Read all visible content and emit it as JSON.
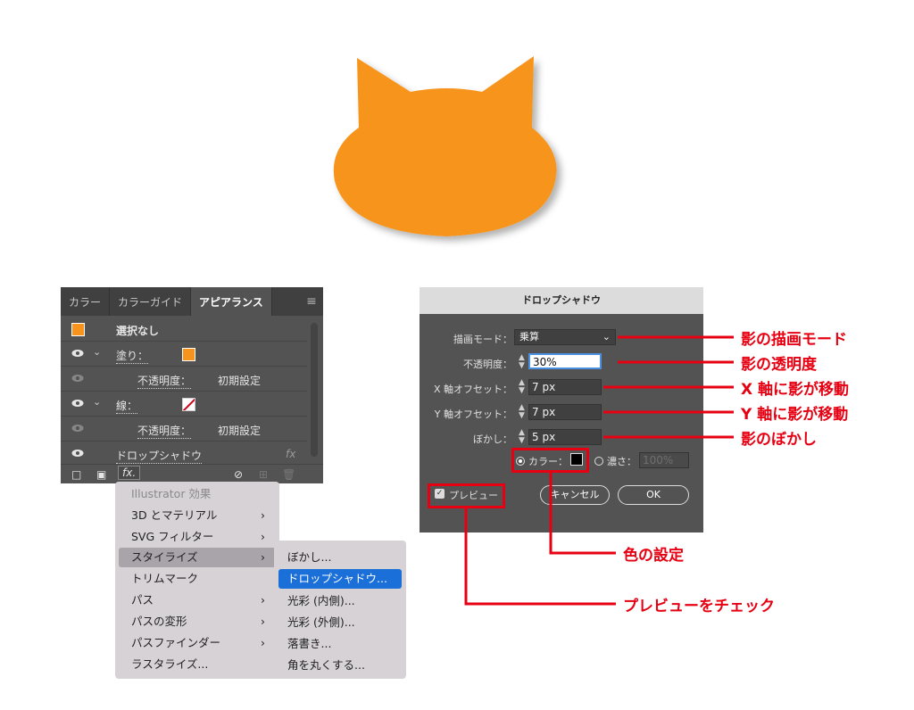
{
  "panel": {
    "tabs": [
      "カラー",
      "カラーガイド",
      "アピアランス"
    ],
    "menu_icon": "hamburger-icon",
    "rows": {
      "selection": "選択なし",
      "fill_label": "塗り：",
      "opacity_label": "不透明度：",
      "opacity_value": "初期設定",
      "stroke_label": "線：",
      "stroke_opacity_label": "不透明度：",
      "stroke_opacity_value": "初期設定",
      "effect_label": "ドロップシャドウ",
      "fx": "fx"
    },
    "footer_fx": "fx."
  },
  "menu": {
    "header": "Illustrator 効果",
    "items": [
      "3D とマテリアル",
      "SVG フィルター",
      "スタイライズ",
      "トリムマーク",
      "パス",
      "パスの変形",
      "パスファインダー",
      "ラスタライズ..."
    ],
    "submenu": [
      "ぼかし...",
      "ドロップシャドウ...",
      "光彩 (内側)...",
      "光彩 (外側)...",
      "落書き...",
      "角を丸くする..."
    ]
  },
  "dialog": {
    "title": "ドロップシャドウ",
    "mode_label": "描画モード：",
    "mode_value": "乗算",
    "opacity_label": "不透明度：",
    "opacity_value": "30%",
    "x_label": "X 軸オフセット：",
    "x_value": "7 px",
    "y_label": "Y 軸オフセット：",
    "y_value": "7 px",
    "blur_label": "ぼかし：",
    "blur_value": "5 px",
    "color_label": "カラー：",
    "darkness_label": "濃さ：",
    "darkness_value": "100%",
    "preview_label": "プレビュー",
    "cancel": "キャンセル",
    "ok": "OK"
  },
  "annotations": {
    "mode": "影の描画モード",
    "opacity": "影の透明度",
    "x": "X 軸に影が移動",
    "y": "Y 軸に影が移動",
    "blur": "影のぼかし",
    "color": "色の設定",
    "preview": "プレビューをチェック"
  },
  "colors": {
    "cat": "#f7941d",
    "annotation": "#e60012",
    "highlight": "#1a6fd8"
  }
}
